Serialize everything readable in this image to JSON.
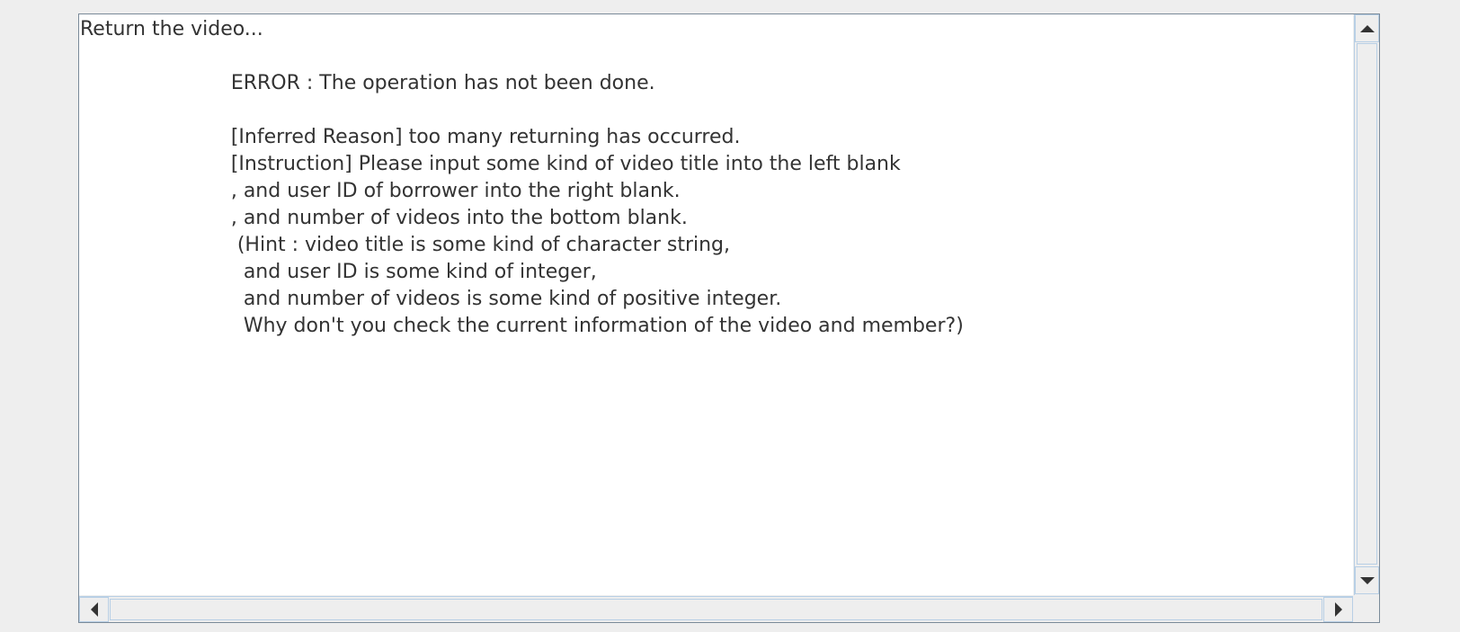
{
  "output_area": {
    "text": "Return the video...\n\n                        ERROR : The operation has not been done.\n\n                        [Inferred Reason] too many returning has occurred.\n                        [Instruction] Please input some kind of video title into the left blank\n                        , and user ID of borrower into the right blank.\n                        , and number of videos into the bottom blank.\n                         (Hint : video title is some kind of character string,\n                          and user ID is some kind of integer,\n                          and number of videos is some kind of positive integer.\n                          Why don't you check the current information of the video and member?)"
  },
  "scrollbars": {
    "vertical": {
      "up_icon": "triangle-up",
      "down_icon": "triangle-down"
    },
    "horizontal": {
      "left_icon": "triangle-left",
      "right_icon": "triangle-right"
    }
  },
  "colors": {
    "background": "#eeeeee",
    "text_area": "#ffffff",
    "text": "#333333",
    "border": "#7a8a99",
    "scroll_border": "#b8cfe5"
  }
}
